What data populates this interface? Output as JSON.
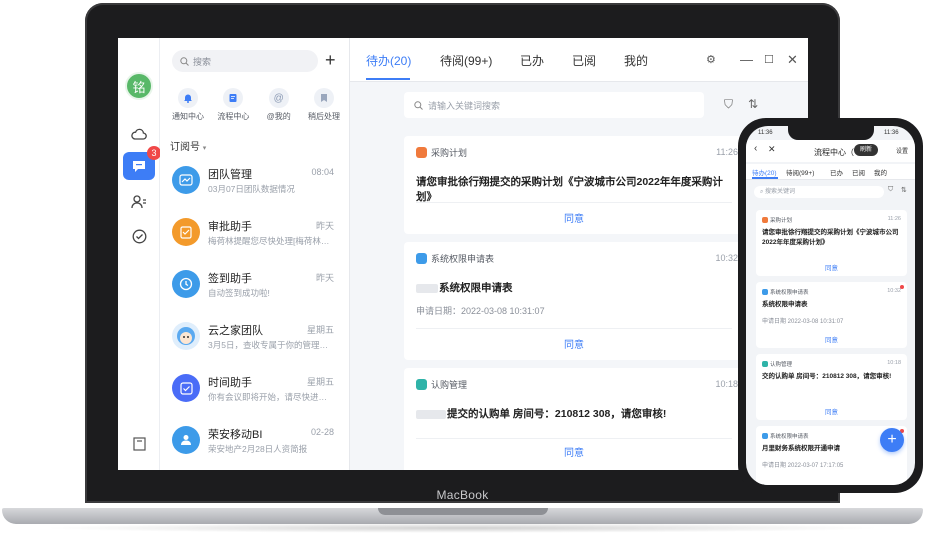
{
  "laptop": {
    "brand": "MacBook",
    "rail": {
      "avatar": "铭",
      "badge": "3"
    },
    "list": {
      "search_placeholder": "搜索",
      "plus": "+",
      "shortcuts": [
        "通知中心",
        "流程中心",
        "@我的",
        "稍后处理"
      ],
      "subscribe_title": "订阅号",
      "conversations": [
        {
          "name": "团队管理",
          "time": "08:04",
          "preview": "03月07日团队数据情况"
        },
        {
          "name": "审批助手",
          "time": "昨天",
          "preview": "梅荷林提醒您尽快处理[梅荷林…"
        },
        {
          "name": "签到助手",
          "time": "昨天",
          "preview": "自动签到成功啦!"
        },
        {
          "name": "云之家团队",
          "time": "星期五",
          "preview": "3月5日，查收专属于你的管理…"
        },
        {
          "name": "时间助手",
          "time": "星期五",
          "preview": "你有会议即将开始，请尽快进…"
        },
        {
          "name": "荣安移动BI",
          "time": "02-28",
          "preview": "荣安地产2月28日人资简报"
        }
      ]
    },
    "main": {
      "tabs": [
        "待办(20)",
        "待阅(99+)",
        "已办",
        "已阅",
        "我的"
      ],
      "keyword_placeholder": "请输入关键词搜索",
      "cards": [
        {
          "tag": "采购计划",
          "time": "11:26",
          "title": "请您审批徐行翔提交的采购计划《宁波城市公司2022年年度采购计划》",
          "date": "",
          "action": "同意",
          "color": "#f07a3c"
        },
        {
          "tag": "系统权限申请表",
          "time": "10:32",
          "title": "系统权限申请表",
          "date": "申请日期：2022-03-08 10:31:07",
          "action": "同意",
          "color": "#3d9be9"
        },
        {
          "tag": "认购管理",
          "time": "10:18",
          "title": "提交的认购单 房间号：210812 308，请您审核!",
          "date": "",
          "action": "同意",
          "color": "#2fb3a8"
        }
      ]
    }
  },
  "phone": {
    "status_time": "11:36",
    "status_right": "11:36",
    "title": "流程中心（",
    "refresh": "刷新",
    "settings": "设置",
    "tabs": [
      "待办(20)",
      "待阅(99+)",
      "已办",
      "已阅",
      "我的"
    ],
    "search_placeholder": "搜索关键词",
    "cards": [
      {
        "tag": "采购计划",
        "time": "11:26",
        "text": "请您审批徐行翔提交的采购计划《宁波城市公司2022年年度采购计划》",
        "date": "",
        "action": "同意"
      },
      {
        "tag": "系统权限申请表",
        "time": "10:32",
        "text": "系统权限申请表",
        "date": "申请日期  2022-03-08 10:31:07",
        "action": "同意"
      },
      {
        "tag": "认购管理",
        "time": "10:18",
        "text": "交的认购单 房间号：210812 308，请您审核!",
        "date": "",
        "action": "同意"
      },
      {
        "tag": "系统权限申请表",
        "time": "",
        "text": "月里财务系统权限开通申请",
        "date": "申请日期  2022-03-07 17:17:05",
        "action": ""
      }
    ],
    "fab": "+"
  }
}
